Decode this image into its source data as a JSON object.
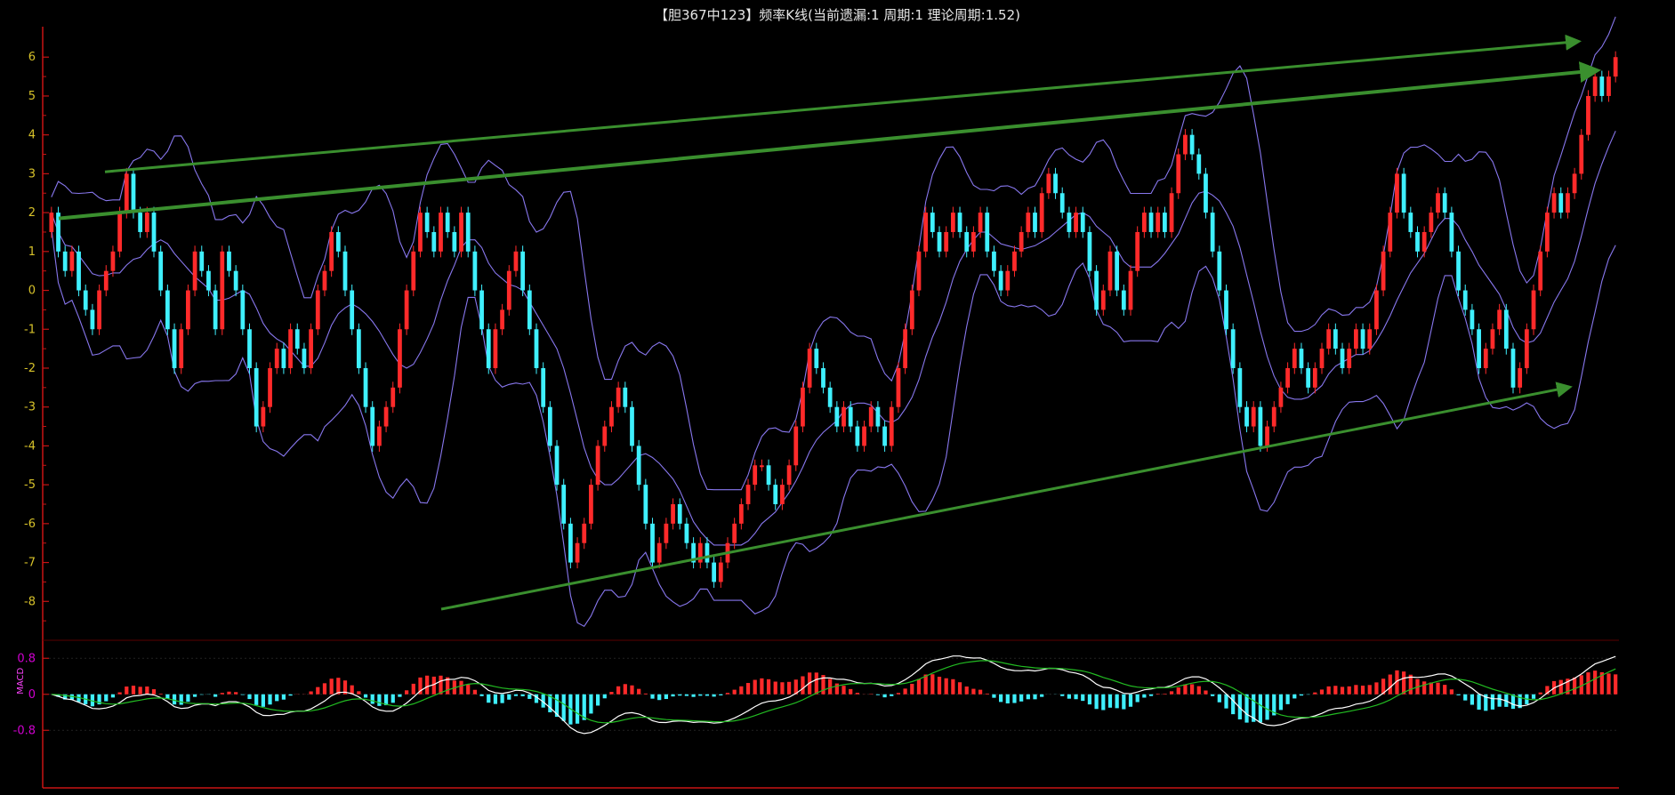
{
  "window": {
    "title": "【胆367中123】频率K线(当前遗漏:1 周期:1 理论周期:1.52)"
  },
  "colors": {
    "background": "#000000",
    "axis": "#c81414",
    "tick_text": "#d7c22a",
    "up_candle": "#ff2a2a",
    "down_candle": "#3ff0ff",
    "band": "#8877ee",
    "trend_arrow": "#3a8f2e",
    "macd_dif": "#ffffff",
    "macd_dea": "#22bb22",
    "macd_tick": "#d000d0"
  },
  "chart_data": [
    {
      "type": "candlestick",
      "title": "【胆367中123】频率K线(当前遗漏:1 周期:1 理论周期:1.52)",
      "ylim": [
        -9,
        6.6
      ],
      "yticks": [
        6,
        5,
        4,
        3,
        2,
        1,
        0,
        -1,
        -2,
        -3,
        -4,
        -5,
        -6,
        -7,
        -8
      ],
      "grid": false,
      "close": [
        2,
        1,
        0.5,
        1,
        0,
        -0.5,
        -1,
        0,
        0.5,
        1,
        2,
        3,
        2,
        1.5,
        2,
        1,
        0,
        -1,
        -2,
        -1,
        0,
        1,
        0.5,
        0,
        -1,
        1,
        0.5,
        0,
        -1,
        -2,
        -3.5,
        -3,
        -2,
        -1.5,
        -2,
        -1,
        -1.5,
        -2,
        -1,
        0,
        0.5,
        1.5,
        1,
        0,
        -1,
        -2,
        -3,
        -4,
        -3.5,
        -3,
        -2.5,
        -1,
        0,
        1,
        2,
        1.5,
        1,
        2,
        1.5,
        1,
        2,
        1,
        0,
        -1,
        -2,
        -1,
        -0.5,
        0.5,
        1,
        0,
        -1,
        -2,
        -3,
        -4,
        -5,
        -6,
        -7,
        -6.5,
        -6,
        -5,
        -4,
        -3.5,
        -3,
        -2.5,
        -3,
        -4,
        -5,
        -6,
        -7,
        -6.5,
        -6,
        -5.5,
        -6,
        -6.5,
        -7,
        -6.5,
        -7,
        -7.5,
        -7,
        -6.5,
        -6,
        -5.5,
        -5,
        -4.5,
        -4.5,
        -5,
        -5.5,
        -5,
        -4.5,
        -3.5,
        -2.5,
        -1.5,
        -2,
        -2.5,
        -3,
        -3.5,
        -3,
        -3.5,
        -4,
        -3.5,
        -3,
        -3.5,
        -4,
        -3,
        -2,
        -1,
        0,
        1,
        2,
        1.5,
        1,
        1.5,
        2,
        1.5,
        1,
        1.5,
        2,
        1,
        0.5,
        0,
        0.5,
        1,
        1.5,
        2,
        1.5,
        2.5,
        3,
        2.5,
        2,
        1.5,
        2,
        1.5,
        0.5,
        -0.5,
        0,
        1,
        0,
        -0.5,
        0.5,
        1.5,
        2,
        1.5,
        2,
        1.5,
        2.5,
        3.5,
        4,
        3.5,
        3,
        2,
        1,
        0,
        -1,
        -2,
        -3,
        -3.5,
        -3,
        -4,
        -3.5,
        -3,
        -2.5,
        -2,
        -1.5,
        -2,
        -2.5,
        -2,
        -1.5,
        -1,
        -1.5,
        -2,
        -1.5,
        -1,
        -1.5,
        -1,
        0,
        1,
        2,
        3,
        2,
        1.5,
        1,
        1.5,
        2,
        2.5,
        2,
        1,
        0,
        -0.5,
        -1,
        -2,
        -1.5,
        -1,
        -0.5,
        -1.5,
        -2.5,
        -2,
        -1,
        0,
        1,
        2,
        2.5,
        2,
        2.5,
        3,
        4,
        5,
        5.5,
        5,
        5.5,
        6
      ]
    },
    {
      "type": "macd",
      "ylim": [
        -2,
        1.2
      ],
      "yticks": [
        0.8,
        0,
        -0.8
      ],
      "ytick_labels": [
        "0.8",
        "0",
        "-0.8"
      ],
      "side_label": "MACD"
    }
  ]
}
